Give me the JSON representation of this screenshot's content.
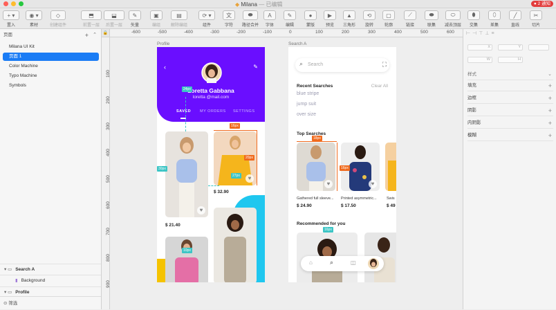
{
  "window": {
    "title": "Milana",
    "subtitle": "已编辑",
    "notice": "● 2 通知"
  },
  "toolbar": [
    {
      "label": "置入",
      "icon": "+ ▾"
    },
    {
      "label": "素材",
      "icon": "◉ ▾"
    },
    {
      "label": "创建组件",
      "icon": "◇"
    },
    {
      "label": "前置一层",
      "icon": "⬒"
    },
    {
      "label": "后置一层",
      "icon": "⬓"
    },
    {
      "label": "矢量",
      "icon": "✎"
    },
    {
      "label": "编组",
      "icon": "▣"
    },
    {
      "label": "解除编组",
      "icon": "▤"
    },
    {
      "label": "组件",
      "icon": "⟳ ▾"
    },
    {
      "label": "字符",
      "icon": "文"
    },
    {
      "label": "路径合并",
      "icon": "⬬"
    },
    {
      "label": "字体",
      "icon": "A"
    },
    {
      "label": "编辑",
      "icon": "✎"
    },
    {
      "label": "蒙版",
      "icon": "●"
    },
    {
      "label": "预览",
      "icon": "▶"
    },
    {
      "label": "三角形",
      "icon": "▲"
    },
    {
      "label": "旋转",
      "icon": "⟲"
    },
    {
      "label": "轮廓",
      "icon": "▢"
    },
    {
      "label": "链接",
      "icon": "⟋"
    },
    {
      "label": "联集",
      "icon": "⬬"
    },
    {
      "label": "减去顶层",
      "icon": "⬭"
    },
    {
      "label": "交集",
      "icon": "⬮"
    },
    {
      "label": "差集",
      "icon": "⬯"
    },
    {
      "label": "直线",
      "icon": "╱"
    },
    {
      "label": "切片",
      "icon": "✂"
    }
  ],
  "left_panel": {
    "pages_header": "页面",
    "pages": [
      "Milana UI Kit",
      "页面 1",
      "Color Machine",
      "Typo Machine",
      "Symbols"
    ],
    "selected_page": "页面 1",
    "layers": [
      {
        "name": "Search A",
        "level": 0
      },
      {
        "name": "Background",
        "level": 1
      },
      {
        "name": "Profile",
        "level": 0
      }
    ],
    "filter_label": "筛选"
  },
  "ruler_top": [
    "-600",
    "-500",
    "-400",
    "-300",
    "-200",
    "-100",
    "0",
    "100",
    "200",
    "300",
    "400",
    "500",
    "600"
  ],
  "ruler_left": [
    "100",
    "200",
    "300",
    "400",
    "500",
    "600",
    "700",
    "800",
    "900"
  ],
  "right_panel": {
    "fields": [
      "X",
      "Y",
      "W",
      "H"
    ],
    "style_header": "样式",
    "rows": [
      "填充",
      "边框",
      "阴影",
      "内阴影",
      "模糊"
    ]
  },
  "artboards": {
    "profile": {
      "label": "Profile",
      "user_name": "Loretta Gabbana",
      "user_email": "loretta @mail.com",
      "tabs": [
        "SAVED",
        "MY ORDERS",
        "SETTINGS"
      ],
      "active_tab": "SAVED",
      "prices": [
        "$ 32.90",
        "$ 21.40"
      ],
      "measures": [
        "24px",
        "16px",
        "20px",
        "30px",
        "10px",
        "27px",
        "20px"
      ]
    },
    "search": {
      "label": "Search A",
      "search_placeholder": "Search",
      "recent_title": "Recent Searches",
      "clear_all": "Clear All",
      "recent": [
        "blue stripe",
        "jump suit",
        "over size"
      ],
      "top_title": "Top Searches",
      "top_items": [
        {
          "name": "Gathered full sleeve...",
          "price": "$ 24.90"
        },
        {
          "name": "Printed asymmetric...",
          "price": "$ 17.50"
        },
        {
          "name": "Swis",
          "price": "$ 49"
        }
      ],
      "recommended_title": "Recommended for you",
      "measures": [
        "18px",
        "16px",
        "16px"
      ]
    }
  },
  "colors": {
    "accent": "#6a0eff",
    "selection": "#1a7cf5",
    "cyan": "#1fc7ef",
    "yellow": "#f5c300",
    "orange": "#f06a1d"
  }
}
